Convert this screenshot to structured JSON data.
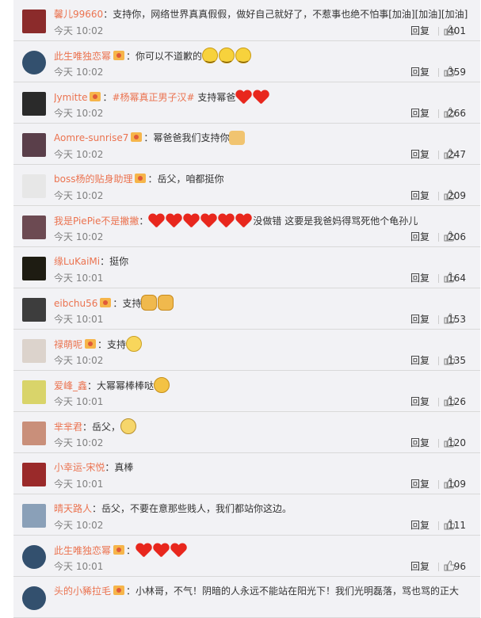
{
  "comments": [
    {
      "user": "馨儿99660",
      "badge": false,
      "parts": [
        {
          "t": "支持你，网络世界真真假假，做好自己就好了，不惹事也绝不怕事[加油][加油][加油]"
        }
      ],
      "time": "今天 10:02",
      "reply": "回复",
      "likes": "401",
      "avatar": "#8b2b2b"
    },
    {
      "user": "此生唯独恋幂",
      "badge": true,
      "parts": [
        {
          "t": "你可以不道歉的"
        },
        {
          "e": "smile"
        },
        {
          "e": "smile"
        },
        {
          "e": "smile"
        }
      ],
      "time": "今天 10:02",
      "reply": "回复",
      "likes": "359",
      "avatar": "#33506e"
    },
    {
      "user": "Jymitte",
      "badge": true,
      "parts": [
        {
          "h": "#杨幂真正男子汉#"
        },
        {
          "t": " 支持幂爸"
        },
        {
          "e": "heart"
        },
        {
          "e": "heart"
        }
      ],
      "time": "今天 10:02",
      "reply": "回复",
      "likes": "266",
      "avatar": "#2a2a2a"
    },
    {
      "user": "Aomre-sunrise7",
      "badge": true,
      "parts": [
        {
          "t": "幂爸爸我们支持你"
        },
        {
          "e": "thumb"
        }
      ],
      "time": "今天 10:02",
      "reply": "回复",
      "likes": "247",
      "avatar": "#5a3f4a"
    },
    {
      "user": "boss杨的贴身助理",
      "badge": true,
      "parts": [
        {
          "t": "岳父，咱都挺你"
        }
      ],
      "time": "今天 10:02",
      "reply": "回复",
      "likes": "209",
      "avatar": "#e7e7e7"
    },
    {
      "user": "我是PiePie不是撇撇",
      "badge": false,
      "parts": [
        {
          "e": "heart"
        },
        {
          "e": "heart"
        },
        {
          "e": "heart"
        },
        {
          "e": "heart"
        },
        {
          "e": "heart"
        },
        {
          "e": "heart"
        },
        {
          "t": "没做错 这要是我爸妈得骂死他个龟孙儿"
        }
      ],
      "time": "今天 10:02",
      "reply": "回复",
      "likes": "206",
      "avatar": "#6c4a52"
    },
    {
      "user": "缘LuKaiMi",
      "badge": false,
      "parts": [
        {
          "t": "挺你"
        }
      ],
      "time": "今天 10:01",
      "reply": "回复",
      "likes": "164",
      "avatar": "#1e1c12"
    },
    {
      "user": "eibchu56",
      "badge": true,
      "parts": [
        {
          "t": "支持"
        },
        {
          "e": "fist"
        },
        {
          "e": "fist"
        }
      ],
      "time": "今天 10:01",
      "reply": "回复",
      "likes": "153",
      "avatar": "#3d3d3d"
    },
    {
      "user": "禄萌呢",
      "badge": true,
      "parts": [
        {
          "t": "支持"
        },
        {
          "e": "relieved"
        }
      ],
      "time": "今天 10:02",
      "reply": "回复",
      "likes": "135",
      "avatar": "#dcd3cc"
    },
    {
      "user": "爱峰_鑫",
      "badge": false,
      "parts": [
        {
          "t": "大幂幂棒棒哒"
        },
        {
          "e": "tease"
        }
      ],
      "time": "今天 10:01",
      "reply": "回复",
      "likes": "126",
      "avatar": "#d9d46a"
    },
    {
      "user": "芈芈君",
      "badge": false,
      "parts": [
        {
          "t": "岳父，"
        },
        {
          "e": "sad"
        }
      ],
      "time": "今天 10:02",
      "reply": "回复",
      "likes": "120",
      "avatar": "#c98f7a"
    },
    {
      "user": "小幸运-宋悦",
      "badge": false,
      "parts": [
        {
          "t": "真棒"
        }
      ],
      "time": "今天 10:01",
      "reply": "回复",
      "likes": "109",
      "avatar": "#9a2a2a"
    },
    {
      "user": "晴天路人",
      "badge": false,
      "parts": [
        {
          "t": "岳父，不要在意那些贱人，我们都站你这边。"
        }
      ],
      "time": "今天 10:02",
      "reply": "回复",
      "likes": "111",
      "avatar": "#8aa0b8"
    },
    {
      "user": "此生唯独恋幂",
      "badge": true,
      "parts": [
        {
          "e": "heart"
        },
        {
          "e": "heart"
        },
        {
          "e": "heart"
        }
      ],
      "time": "今天 10:01",
      "reply": "回复",
      "likes": "96",
      "avatar": "#33506e"
    },
    {
      "user": "头的小豨拉毛",
      "badge": true,
      "parts": [
        {
          "t": "小林哥，不气！阴暗的人永远不能站在阳光下！我们光明磊落，骂也骂的正大"
        }
      ],
      "time": "",
      "reply": "",
      "likes": "",
      "avatar": "#33506e"
    }
  ]
}
